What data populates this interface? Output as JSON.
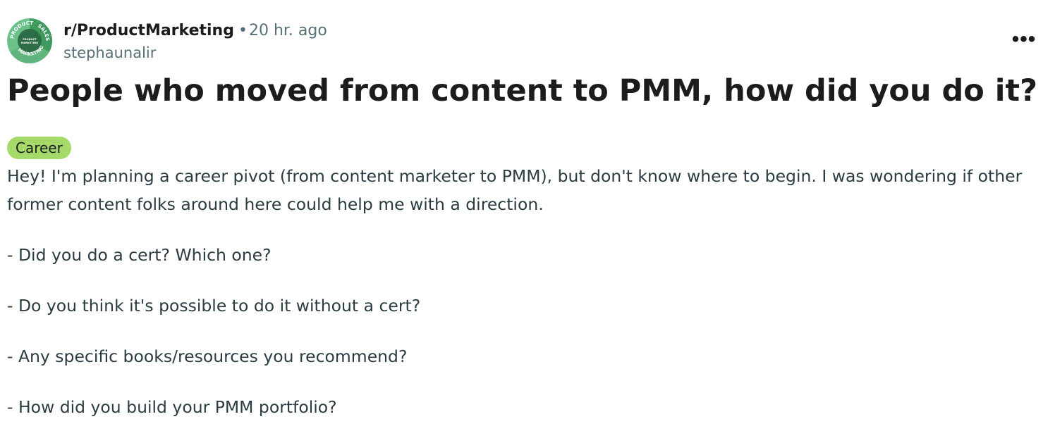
{
  "post": {
    "subreddit": "r/ProductMarketing",
    "separator": "•",
    "time": "20 hr. ago",
    "author": "stephaunalir",
    "more_label": "•••",
    "title": "People who moved from content to PMM, how did you do it?",
    "flair": "Career",
    "paragraphs": [
      "Hey! I'm planning a career pivot (from content marketer to PMM), but don't know where to begin. I was wondering if other former content folks around here could help me with a direction.",
      "- Did you do a cert? Which one?",
      "- Do you think it's possible to do it without a cert?",
      "- Any specific books/resources you recommend?",
      "- How did you build your PMM portfolio?"
    ]
  },
  "avatar": {
    "icon": "subreddit-logo-icon",
    "ring_words": [
      "PRODUCT",
      "SALES",
      "MARKETING"
    ],
    "center_text": [
      "PRODUCT",
      "MARKETING"
    ]
  },
  "colors": {
    "flair_bg": "#a5d96a",
    "muted_text": "#576f76",
    "avatar_dark": "#2e6e46",
    "avatar_mid": "#3f9a5e",
    "avatar_light": "#6cc08a"
  }
}
